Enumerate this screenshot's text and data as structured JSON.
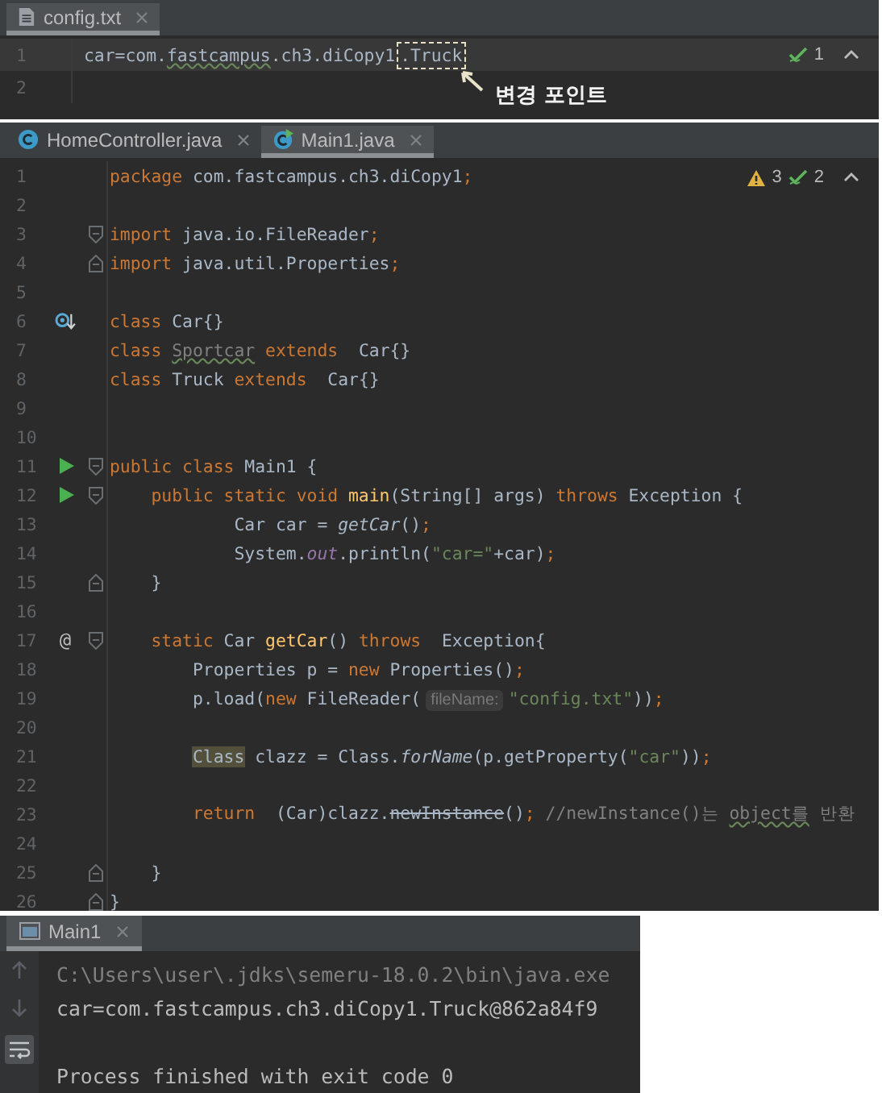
{
  "config_editor": {
    "tabs": [
      {
        "label": "config.txt",
        "selected": true,
        "kind": "text"
      }
    ],
    "inspection": {
      "checks": "1"
    },
    "lines": [
      {
        "number": "1",
        "current": true,
        "tokens": [
          {
            "text": "car=com.",
            "kind": "plain"
          },
          {
            "text": "fastcampus",
            "kind": "typo"
          },
          {
            "text": ".ch3.diCopy1",
            "kind": "plain"
          },
          {
            "text": ".Truck",
            "kind": "callout"
          }
        ]
      },
      {
        "number": "2",
        "current": false
      }
    ],
    "annotation": {
      "text": "변경 포인트"
    }
  },
  "main_editor": {
    "tabs": [
      {
        "label": "HomeController.java",
        "selected": false,
        "kind": "class"
      },
      {
        "label": "Main1.java",
        "selected": true,
        "kind": "runnable"
      }
    ],
    "inspection": {
      "warnings": "3",
      "checks": "2"
    },
    "lines": [
      {
        "number": "1",
        "tokens": [
          {
            "text": "package",
            "kind": "keyword"
          },
          {
            "text": " com.fastcampus.ch3.diCopy1",
            "kind": "plain"
          },
          {
            "text": ";",
            "kind": "keyword"
          }
        ]
      },
      {
        "number": "2"
      },
      {
        "number": "3",
        "fold": {
          "kind": "start"
        },
        "tokens": [
          {
            "text": "import",
            "kind": "keyword"
          },
          {
            "text": " java.io.FileReader",
            "kind": "plain"
          },
          {
            "text": ";",
            "kind": "keyword"
          }
        ]
      },
      {
        "number": "4",
        "fold": {
          "kind": "end"
        },
        "tokens": [
          {
            "text": "import",
            "kind": "keyword"
          },
          {
            "text": " java.util.Properties",
            "kind": "plain"
          },
          {
            "text": ";",
            "kind": "keyword"
          }
        ]
      },
      {
        "number": "5"
      },
      {
        "number": "6",
        "gutter": {
          "kind": "implemented"
        },
        "tokens": [
          {
            "text": "class",
            "kind": "keyword"
          },
          {
            "text": " Car{}",
            "kind": "plain"
          }
        ]
      },
      {
        "number": "7",
        "tokens": [
          {
            "text": "class ",
            "kind": "keyword"
          },
          {
            "text": "Sportcar",
            "kind": "unused"
          },
          {
            "text": " extends",
            "kind": "keyword"
          },
          {
            "text": "  Car{}",
            "kind": "plain"
          }
        ]
      },
      {
        "number": "8",
        "tokens": [
          {
            "text": "class",
            "kind": "keyword"
          },
          {
            "text": " Truck",
            "kind": "plain"
          },
          {
            "text": " extends",
            "kind": "keyword"
          },
          {
            "text": "  Car{}",
            "kind": "plain"
          }
        ]
      },
      {
        "number": "9"
      },
      {
        "number": "10"
      },
      {
        "number": "11",
        "gutter": {
          "kind": "run"
        },
        "fold": {
          "kind": "start"
        },
        "tokens": [
          {
            "text": "public class",
            "kind": "keyword"
          },
          {
            "text": " Main1 {",
            "kind": "plain"
          }
        ]
      },
      {
        "number": "12",
        "gutter": {
          "kind": "run"
        },
        "fold": {
          "kind": "start"
        },
        "tokens": [
          {
            "text": "    public static void ",
            "kind": "keyword"
          },
          {
            "text": "main",
            "kind": "decl"
          },
          {
            "text": "(String[] args) ",
            "kind": "plain"
          },
          {
            "text": "throws",
            "kind": "keyword"
          },
          {
            "text": " Exception {",
            "kind": "plain"
          }
        ]
      },
      {
        "number": "13",
        "tokens": [
          {
            "text": "            Car car = ",
            "kind": "plain"
          },
          {
            "text": "getCar",
            "kind": "static"
          },
          {
            "text": "()",
            "kind": "plain"
          },
          {
            "text": ";",
            "kind": "keyword"
          }
        ]
      },
      {
        "number": "14",
        "tokens": [
          {
            "text": "            System.",
            "kind": "plain"
          },
          {
            "text": "out",
            "kind": "field"
          },
          {
            "text": ".println(",
            "kind": "plain"
          },
          {
            "text": "\"car=\"",
            "kind": "string"
          },
          {
            "text": "+car)",
            "kind": "plain"
          },
          {
            "text": ";",
            "kind": "keyword"
          }
        ]
      },
      {
        "number": "15",
        "fold": {
          "kind": "end"
        },
        "tokens": [
          {
            "text": "    }",
            "kind": "plain"
          }
        ]
      },
      {
        "number": "16"
      },
      {
        "number": "17",
        "gutter_text": "@",
        "fold": {
          "kind": "start"
        },
        "tokens": [
          {
            "text": "    static",
            "kind": "keyword"
          },
          {
            "text": " Car ",
            "kind": "plain"
          },
          {
            "text": "getCar",
            "kind": "decl"
          },
          {
            "text": "() ",
            "kind": "plain"
          },
          {
            "text": "throws",
            "kind": "keyword"
          },
          {
            "text": "  Exception{",
            "kind": "plain"
          }
        ]
      },
      {
        "number": "18",
        "tokens": [
          {
            "text": "        Properties p = ",
            "kind": "plain"
          },
          {
            "text": "new",
            "kind": "keyword"
          },
          {
            "text": " Properties()",
            "kind": "plain"
          },
          {
            "text": ";",
            "kind": "keyword"
          }
        ]
      },
      {
        "number": "19",
        "tokens": [
          {
            "text": "        p.load(",
            "kind": "plain"
          },
          {
            "text": "new",
            "kind": "keyword"
          },
          {
            "text": " FileReader(",
            "kind": "plain"
          },
          {
            "text": "fileName:",
            "kind": "hint"
          },
          {
            "text": "\"config.txt\"",
            "kind": "string"
          },
          {
            "text": "))",
            "kind": "plain"
          },
          {
            "text": ";",
            "kind": "keyword"
          }
        ]
      },
      {
        "number": "20"
      },
      {
        "number": "21",
        "tokens": [
          {
            "text": "        Class",
            "kind": "marked"
          },
          {
            "text": " clazz = Class.",
            "kind": "plain"
          },
          {
            "text": "forName",
            "kind": "static"
          },
          {
            "text": "(p.getProperty(",
            "kind": "plain"
          },
          {
            "text": "\"car\"",
            "kind": "string"
          },
          {
            "text": "))",
            "kind": "plain"
          },
          {
            "text": ";",
            "kind": "keyword"
          }
        ]
      },
      {
        "number": "22"
      },
      {
        "number": "23",
        "tokens": [
          {
            "text": "        return",
            "kind": "keyword"
          },
          {
            "text": "  (Car)clazz.",
            "kind": "plain"
          },
          {
            "text": "newInstance",
            "kind": "deprecated"
          },
          {
            "text": "()",
            "kind": "plain"
          },
          {
            "text": ";",
            "kind": "keyword"
          },
          {
            "text": " //newInstance()는 ",
            "kind": "comment"
          },
          {
            "text": "object를",
            "kind": "typo-comment"
          },
          {
            "text": " 반환",
            "kind": "comment"
          }
        ]
      },
      {
        "number": "24"
      },
      {
        "number": "25",
        "fold": {
          "kind": "end"
        },
        "tokens": [
          {
            "text": "    }",
            "kind": "plain"
          }
        ]
      },
      {
        "number": "26",
        "fold": {
          "kind": "end"
        },
        "tokens": [
          {
            "text": "}",
            "kind": "plain"
          }
        ]
      }
    ]
  },
  "console": {
    "tabs": [
      {
        "label": "Main1",
        "selected": true
      }
    ],
    "lines": [
      {
        "text": "C:\\Users\\user\\.jdks\\semeru-18.0.2\\bin\\java.exe",
        "kind": "command"
      },
      {
        "text": "car=com.fastcampus.ch3.diCopy1.Truck@862a84f9",
        "kind": "output"
      },
      {
        "text": "Process finished with exit code 0",
        "kind": "status"
      }
    ]
  }
}
